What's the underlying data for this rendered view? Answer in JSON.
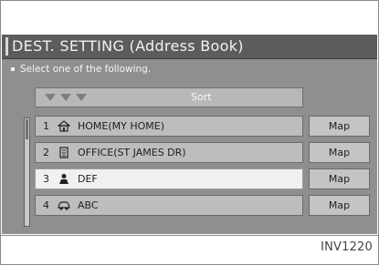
{
  "screen": {
    "title": "DEST. SETTING (Address Book)",
    "instruction": "Select one of the following."
  },
  "sort": {
    "label": "Sort"
  },
  "entries": [
    {
      "number": "1",
      "name": "HOME(MY HOME)",
      "icon": "house-icon",
      "map_label": "Map"
    },
    {
      "number": "2",
      "name": "OFFICE(ST JAMES DR)",
      "icon": "office-building-icon",
      "map_label": "Map"
    },
    {
      "number": "3",
      "name": "DEF",
      "icon": "person-icon",
      "map_label": "Map",
      "selected": true
    },
    {
      "number": "4",
      "name": "ABC",
      "icon": "car-icon",
      "map_label": "Map"
    }
  ],
  "footer": {
    "code": "INV1220"
  },
  "colors": {
    "screen_bg": "#8f8f8f",
    "title_bar": "#5c5c5c",
    "row_bg": "#bdbdbd",
    "row_selected": "#f0f0f0"
  }
}
